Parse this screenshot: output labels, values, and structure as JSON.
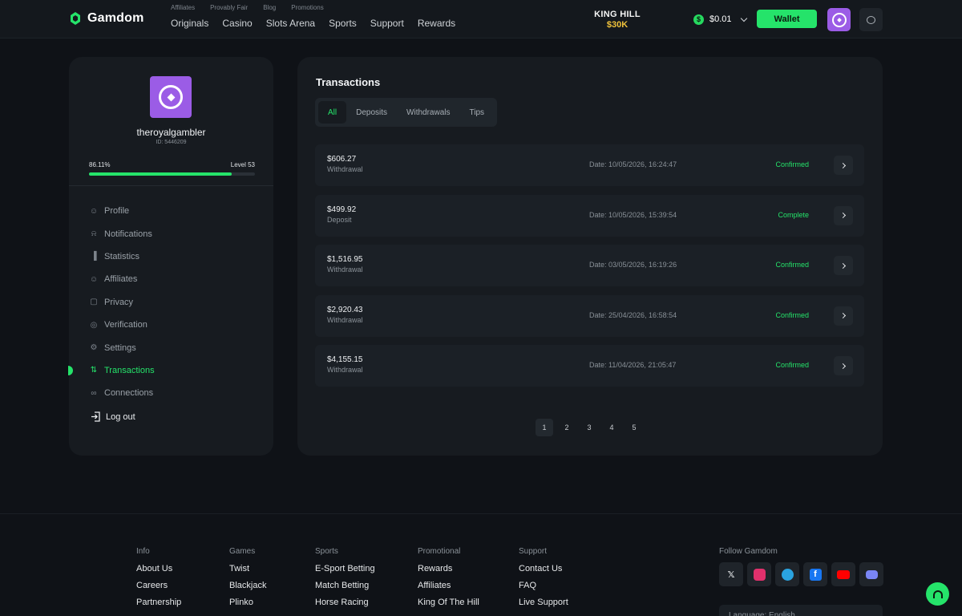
{
  "header": {
    "brand": "Gamdom",
    "sub_links": [
      "Affiliates",
      "Provably Fair",
      "Blog",
      "Promotions"
    ],
    "nav": [
      "Originals",
      "Casino",
      "Slots Arena",
      "Sports",
      "Support",
      "Rewards"
    ],
    "promo_line1": "KING HILL",
    "promo_line2": "$30K",
    "balance": "$0.01",
    "wallet_label": "Wallet"
  },
  "profile": {
    "username": "theroyalgambler",
    "id_text": "ID: 5446209",
    "progress_text": "86.11%",
    "progress_value": 0.8611,
    "level_text": "Level 53"
  },
  "menu": [
    {
      "label": "Profile",
      "icon": "user-icon"
    },
    {
      "label": "Notifications",
      "icon": "bell-icon"
    },
    {
      "label": "Statistics",
      "icon": "bar-chart-icon"
    },
    {
      "label": "Affiliates",
      "icon": "smile-icon"
    },
    {
      "label": "Privacy",
      "icon": "lock-icon"
    },
    {
      "label": "Verification",
      "icon": "check-circle-icon"
    },
    {
      "label": "Settings",
      "icon": "gear-icon"
    },
    {
      "label": "Transactions",
      "icon": "transfer-icon",
      "active": true
    },
    {
      "label": "Connections",
      "icon": "link-icon"
    }
  ],
  "logout_label": "Log out",
  "transactions": {
    "title": "Transactions",
    "tabs": [
      "All",
      "Deposits",
      "Withdrawals",
      "Tips"
    ],
    "active_tab": "All",
    "rows": [
      {
        "amount": "$606.27",
        "type": "Withdrawal",
        "date": "Date: 10/05/2026, 16:24:47",
        "status": "Confirmed"
      },
      {
        "amount": "$499.92",
        "type": "Deposit",
        "date": "Date: 10/05/2026, 15:39:54",
        "status": "Complete"
      },
      {
        "amount": "$1,516.95",
        "type": "Withdrawal",
        "date": "Date: 03/05/2026, 16:19:26",
        "status": "Confirmed"
      },
      {
        "amount": "$2,920.43",
        "type": "Withdrawal",
        "date": "Date: 25/04/2026, 16:58:54",
        "status": "Confirmed"
      },
      {
        "amount": "$4,155.15",
        "type": "Withdrawal",
        "date": "Date: 11/04/2026, 21:05:47",
        "status": "Confirmed"
      }
    ],
    "pages": [
      "1",
      "2",
      "3",
      "4",
      "5"
    ],
    "current_page": "1"
  },
  "footer": {
    "columns": [
      {
        "heading": "Info",
        "items": [
          "About Us",
          "Careers",
          "Partnership"
        ]
      },
      {
        "heading": "Games",
        "items": [
          "Twist",
          "Blackjack",
          "Plinko"
        ]
      },
      {
        "heading": "Sports",
        "items": [
          "E-Sport Betting",
          "Match Betting",
          "Horse Racing"
        ]
      },
      {
        "heading": "Promotional",
        "items": [
          "Rewards",
          "Affiliates",
          "King Of The Hill"
        ]
      },
      {
        "heading": "Support",
        "items": [
          "Contact Us",
          "FAQ",
          "Live Support"
        ]
      }
    ],
    "follow_label": "Follow Gamdom",
    "socials": [
      "x-icon",
      "instagram-icon",
      "telegram-icon",
      "facebook-icon",
      "youtube-icon",
      "discord-icon"
    ],
    "language_text": "Language: English"
  },
  "colors": {
    "accent": "#25e36a",
    "brand_purple": "#9b5ce6",
    "background": "#0f1217",
    "panel": "#171b20"
  }
}
